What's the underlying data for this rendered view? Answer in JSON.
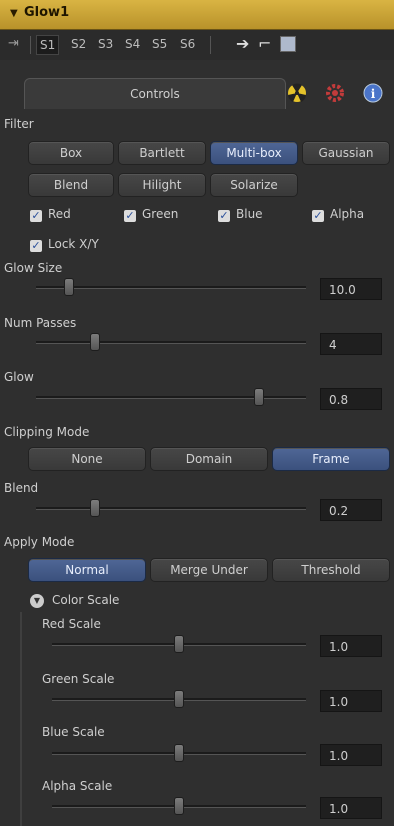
{
  "header": {
    "title": "Glow1"
  },
  "toolbar": {
    "slots": [
      "S1",
      "S2",
      "S3",
      "S4",
      "S5",
      "S6"
    ]
  },
  "tabs": {
    "controls": "Controls"
  },
  "filter": {
    "label": "Filter",
    "options": [
      "Box",
      "Bartlett",
      "Multi-box",
      "Gaussian",
      "Blend",
      "Hilight",
      "Solarize"
    ],
    "selected": "Multi-box"
  },
  "channels": {
    "red": "Red",
    "green": "Green",
    "blue": "Blue",
    "alpha": "Alpha",
    "lock": "Lock X/Y"
  },
  "sliders": {
    "glow_size": {
      "label": "Glow Size",
      "value": "10.0"
    },
    "num_passes": {
      "label": "Num Passes",
      "value": "4"
    },
    "glow": {
      "label": "Glow",
      "value": "0.8"
    },
    "blend": {
      "label": "Blend",
      "value": "0.2"
    }
  },
  "clipping": {
    "label": "Clipping Mode",
    "options": [
      "None",
      "Domain",
      "Frame"
    ],
    "selected": "Frame"
  },
  "apply": {
    "label": "Apply Mode",
    "options": [
      "Normal",
      "Merge Under",
      "Threshold"
    ],
    "selected": "Normal"
  },
  "color_scale": {
    "label": "Color Scale",
    "red": {
      "label": "Red Scale",
      "value": "1.0"
    },
    "green": {
      "label": "Green Scale",
      "value": "1.0"
    },
    "blue": {
      "label": "Blue Scale",
      "value": "1.0"
    },
    "alpha": {
      "label": "Alpha Scale",
      "value": "1.0"
    }
  },
  "colors": {
    "header": "#d1ab3d",
    "selected": "#465e8c",
    "panel": "#2f2f2f"
  }
}
